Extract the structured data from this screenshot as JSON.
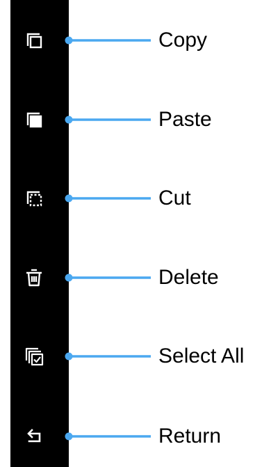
{
  "accent_color": "#4BA8F0",
  "toolbar_color": "#000000",
  "actions": [
    {
      "label": "Copy",
      "icon": "copy-icon"
    },
    {
      "label": "Paste",
      "icon": "paste-icon"
    },
    {
      "label": "Cut",
      "icon": "cut-icon"
    },
    {
      "label": "Delete",
      "icon": "delete-icon"
    },
    {
      "label": "Select All",
      "icon": "select-all-icon"
    },
    {
      "label": "Return",
      "icon": "return-icon"
    }
  ]
}
